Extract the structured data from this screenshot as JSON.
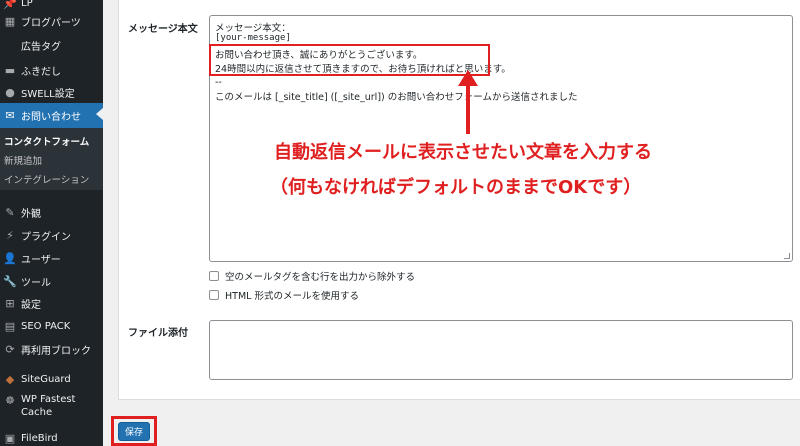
{
  "sidebar": {
    "items": [
      {
        "label": "LP",
        "icon": "pin-icon"
      },
      {
        "label": "ブログパーツ",
        "icon": "blocks-icon"
      },
      {
        "label": "広告タグ",
        "icon": ""
      },
      {
        "label": "ふきだし",
        "icon": "speech-bubble-icon"
      },
      {
        "label": "SWELL設定",
        "icon": "swell-logo-icon"
      },
      {
        "label": "お問い合わせ",
        "icon": "mail-icon"
      },
      {
        "label": "外観",
        "icon": "brush-icon"
      },
      {
        "label": "プラグイン",
        "icon": "plugin-icon"
      },
      {
        "label": "ユーザー",
        "icon": "user-icon"
      },
      {
        "label": "ツール",
        "icon": "wrench-icon"
      },
      {
        "label": "設定",
        "icon": "settings-icon"
      },
      {
        "label": "SEO PACK",
        "icon": "seo-icon"
      },
      {
        "label": "再利用ブロック",
        "icon": "reuse-icon"
      },
      {
        "label": "SiteGuard",
        "icon": "siteguard-icon"
      },
      {
        "label": "WP Fastest Cache",
        "icon": "cheetah-icon"
      },
      {
        "label": "FileBird",
        "icon": "filebird-icon"
      }
    ],
    "submenu": [
      "コンタクトフォーム",
      "新規追加",
      "インテグレーション"
    ]
  },
  "form": {
    "message_label": "メッセージ本文",
    "message_lines": [
      "メッセージ本文：",
      "[your-message]",
      "お問い合わせ頂き、誠にありがとうございます。",
      "24時間以内に返信させて頂きますので、お待ち頂ければと思います。",
      "--",
      "このメールは [_site_title] ([_site_url]) のお問い合わせフォームから送信されました"
    ],
    "checkbox_exclude": "空のメールタグを含む行を出力から除外する",
    "checkbox_html": "HTML 形式のメールを使用する",
    "attachment_label": "ファイル添付",
    "save_label": "保存"
  },
  "annotation": {
    "line1": "自動返信メールに表示させたい文章を入力する",
    "line2": "（何もなければデフォルトのままでOKです）"
  },
  "colors": {
    "accent": "#2271b1",
    "annotation": "#e02020",
    "sidebar": "#1d2327"
  }
}
